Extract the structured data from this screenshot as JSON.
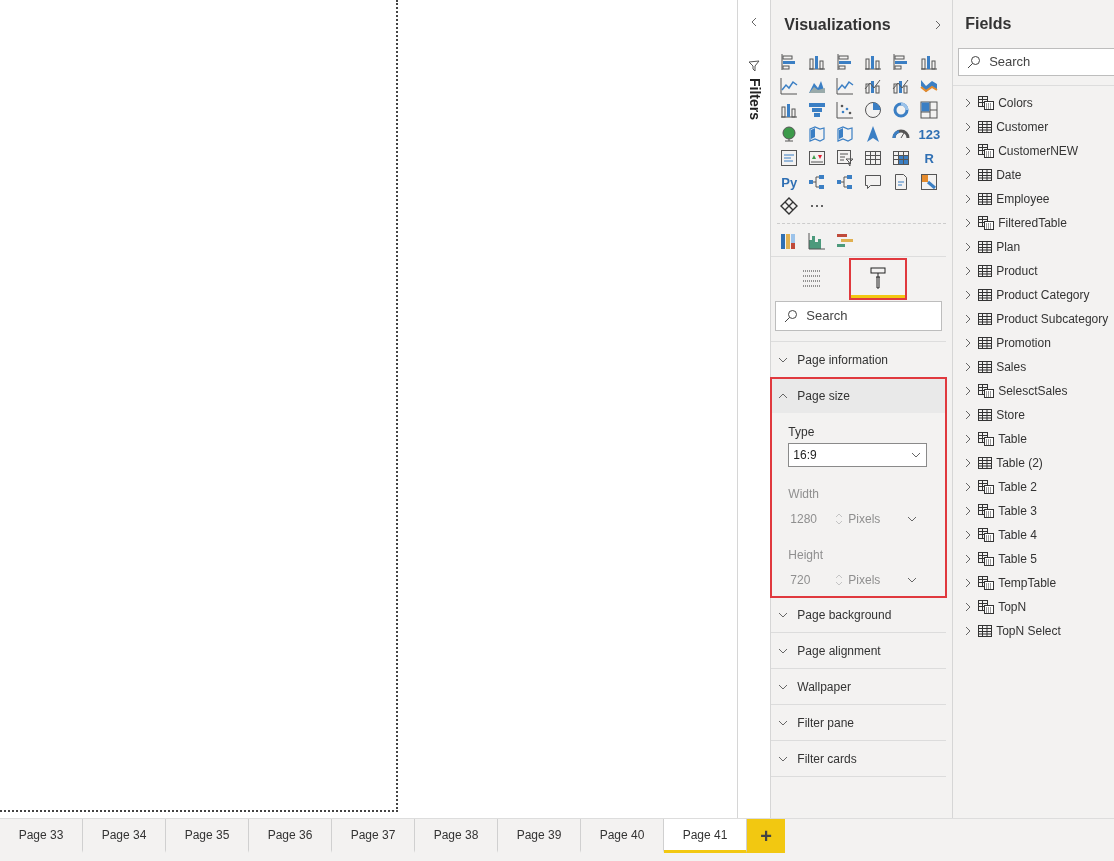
{
  "filters_pane": {
    "title": "Filters"
  },
  "visualizations": {
    "title": "Visualizations",
    "icons": [
      {
        "kind": "hbar"
      },
      {
        "kind": "vbar"
      },
      {
        "kind": "hbar"
      },
      {
        "kind": "vbar"
      },
      {
        "kind": "hbar"
      },
      {
        "kind": "vbar"
      },
      {
        "kind": "line"
      },
      {
        "kind": "area"
      },
      {
        "kind": "line"
      },
      {
        "kind": "combo"
      },
      {
        "kind": "combo"
      },
      {
        "kind": "ribbon"
      },
      {
        "kind": "vbar"
      },
      {
        "kind": "funnel"
      },
      {
        "kind": "scatter"
      },
      {
        "kind": "pie"
      },
      {
        "kind": "donut"
      },
      {
        "kind": "treemap"
      },
      {
        "kind": "globe"
      },
      {
        "kind": "map"
      },
      {
        "kind": "map"
      },
      {
        "kind": "arrow"
      },
      {
        "kind": "gauge"
      },
      {
        "kind": "label",
        "label": "123"
      },
      {
        "kind": "card"
      },
      {
        "kind": "kpi"
      },
      {
        "kind": "slicer"
      },
      {
        "kind": "table"
      },
      {
        "kind": "matrix"
      },
      {
        "kind": "label",
        "label": "R"
      },
      {
        "kind": "label",
        "label": "Py"
      },
      {
        "kind": "tree"
      },
      {
        "kind": "tree"
      },
      {
        "kind": "bubble"
      },
      {
        "kind": "page"
      },
      {
        "kind": "apps"
      },
      {
        "kind": "diamond"
      },
      {
        "kind": "more"
      }
    ],
    "custom_icons": [
      {
        "kind": "stacked"
      },
      {
        "kind": "histogram"
      },
      {
        "kind": "gantt"
      }
    ],
    "pane_tabs": [
      {
        "kind": "fields",
        "selected": false,
        "highlighted": false
      },
      {
        "kind": "format",
        "selected": true,
        "highlighted": true
      }
    ],
    "search": {
      "placeholder": "Search"
    },
    "sections": [
      {
        "title": "Page information",
        "expanded": false,
        "highlighted": false
      },
      {
        "title": "Page size",
        "expanded": true,
        "highlighted": true,
        "type_label": "Type",
        "type_value": "16:9",
        "width_label": "Width",
        "width_value": "1280",
        "width_unit": "Pixels",
        "height_label": "Height",
        "height_value": "720",
        "height_unit": "Pixels",
        "size_disabled": true
      },
      {
        "title": "Page background",
        "expanded": false,
        "highlighted": false
      },
      {
        "title": "Page alignment",
        "expanded": false,
        "highlighted": false
      },
      {
        "title": "Wallpaper",
        "expanded": false,
        "highlighted": false
      },
      {
        "title": "Filter pane",
        "expanded": false,
        "highlighted": false
      },
      {
        "title": "Filter cards",
        "expanded": false,
        "highlighted": false
      }
    ]
  },
  "fields": {
    "title": "Fields",
    "search": {
      "placeholder": "Search"
    },
    "tables": [
      {
        "name": "Colors",
        "kind": "calculated"
      },
      {
        "name": "Customer",
        "kind": "table"
      },
      {
        "name": "CustomerNEW",
        "kind": "calculated"
      },
      {
        "name": "Date",
        "kind": "table"
      },
      {
        "name": "Employee",
        "kind": "table"
      },
      {
        "name": "FilteredTable",
        "kind": "calculated"
      },
      {
        "name": "Plan",
        "kind": "table"
      },
      {
        "name": "Product",
        "kind": "table"
      },
      {
        "name": "Product Category",
        "kind": "table"
      },
      {
        "name": "Product Subcategory",
        "kind": "table"
      },
      {
        "name": "Promotion",
        "kind": "table"
      },
      {
        "name": "Sales",
        "kind": "table"
      },
      {
        "name": "SelesctSales",
        "kind": "calculated"
      },
      {
        "name": "Store",
        "kind": "table"
      },
      {
        "name": "Table",
        "kind": "calculated"
      },
      {
        "name": "Table (2)",
        "kind": "table"
      },
      {
        "name": "Table 2",
        "kind": "calculated"
      },
      {
        "name": "Table 3",
        "kind": "calculated"
      },
      {
        "name": "Table 4",
        "kind": "calculated"
      },
      {
        "name": "Table 5",
        "kind": "calculated"
      },
      {
        "name": "TempTable",
        "kind": "calculated"
      },
      {
        "name": "TopN",
        "kind": "calculated"
      },
      {
        "name": "TopN Select",
        "kind": "table"
      }
    ]
  },
  "page_tabs": [
    {
      "label": "Page 33",
      "selected": false
    },
    {
      "label": "Page 34",
      "selected": false
    },
    {
      "label": "Page 35",
      "selected": false
    },
    {
      "label": "Page 36",
      "selected": false
    },
    {
      "label": "Page 37",
      "selected": false
    },
    {
      "label": "Page 38",
      "selected": false
    },
    {
      "label": "Page 39",
      "selected": false
    },
    {
      "label": "Page 40",
      "selected": false
    },
    {
      "label": "Page 41",
      "selected": true
    }
  ],
  "add_page_button": {
    "label": "+"
  }
}
